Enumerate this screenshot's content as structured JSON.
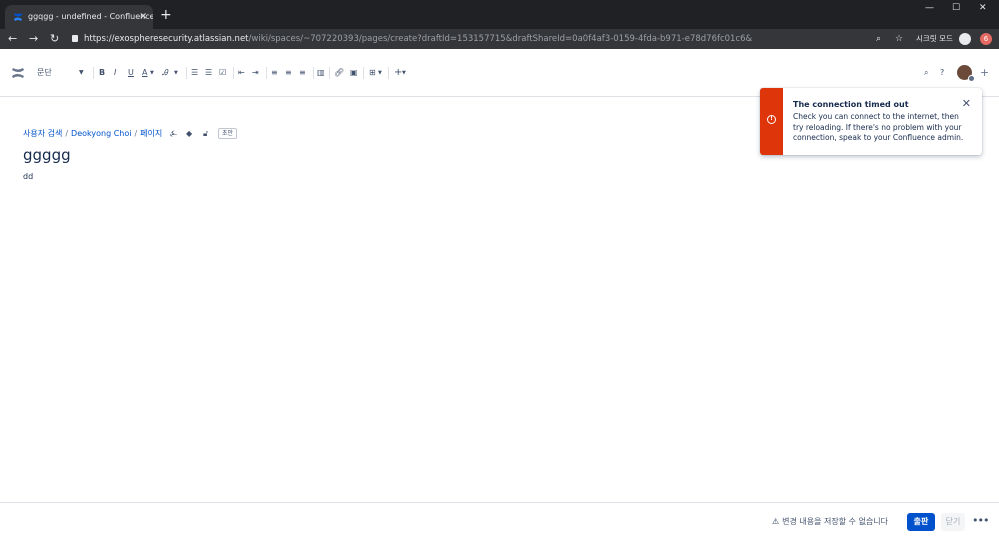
{
  "browser": {
    "tab_title": "ggqgg - undefined - Confluence",
    "tab_close": "✕",
    "new_tab": "+",
    "window_controls": [
      "—",
      "☐",
      "✕"
    ],
    "url_host": "https://exospheresecurity.atlassian.net",
    "url_path": "/wiki/spaces/~707220393/pages/create?draftId=153157715&draftShareId=0a0f4af3-0159-4fda-b971-e78d76fc01c6&",
    "incognito_label": "시크릿 모드",
    "badge": "6"
  },
  "toolbar": {
    "paragraph_style": "문단",
    "bold": "B",
    "italic": "I",
    "underline": "U",
    "text_color": "A",
    "help": "?",
    "insert_more": "+"
  },
  "breadcrumb": {
    "items": [
      "사용자 검색",
      "Deokyong Choi",
      "페이지"
    ],
    "restriction_lozenge": "초안"
  },
  "page": {
    "title": "ggggg",
    "body": "dd"
  },
  "flag": {
    "title": "The connection timed out",
    "description": "Check you can connect to the internet, then try reloading. If there's no problem with your connection, speak to your Confluence admin.",
    "accent_color": "#de350b"
  },
  "footer": {
    "warning": "변경 내용을 저장할 수 없습니다",
    "publish_label": "출판",
    "close_label": "닫기",
    "more": "•••"
  }
}
